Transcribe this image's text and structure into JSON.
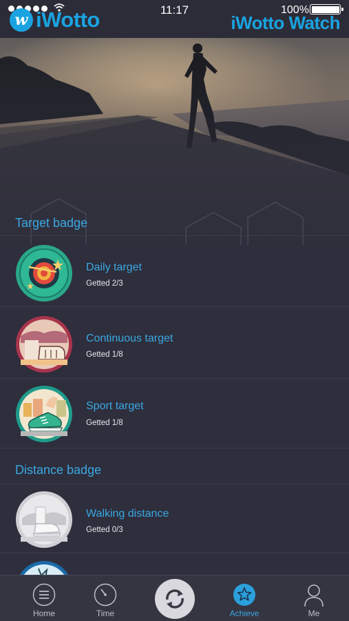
{
  "status": {
    "time": "11:17",
    "battery": "100%"
  },
  "brand": {
    "left": "iWotto",
    "right": "iWotto Watch",
    "mark": "w"
  },
  "sections": [
    {
      "title": "Target badge",
      "badges": [
        {
          "name": "Daily target",
          "progress": "Getted 2/3",
          "icon": "target-badge-icon",
          "color": "#2aa88a"
        },
        {
          "name": "Continuous target",
          "progress": "Getted 1/8",
          "icon": "continuous-badge-icon",
          "color": "#a8344d"
        },
        {
          "name": "Sport target",
          "progress": "Getted 1/8",
          "icon": "sneaker-badge-icon",
          "color": "#1f9a8a"
        }
      ]
    },
    {
      "title": "Distance badge",
      "badges": [
        {
          "name": "Walking distance",
          "progress": "Getted 0/3",
          "icon": "walking-badge-icon",
          "color": "#cfcfd4"
        }
      ]
    }
  ],
  "tabs": [
    {
      "label": "Home",
      "icon": "menu-icon"
    },
    {
      "label": "Time",
      "icon": "stopwatch-icon"
    },
    {
      "label": "Achieve",
      "icon": "star-icon",
      "active": true
    },
    {
      "label": "Me",
      "icon": "person-icon"
    }
  ],
  "colors": {
    "accent": "#3aa8e2",
    "background": "#2e2e3c"
  }
}
